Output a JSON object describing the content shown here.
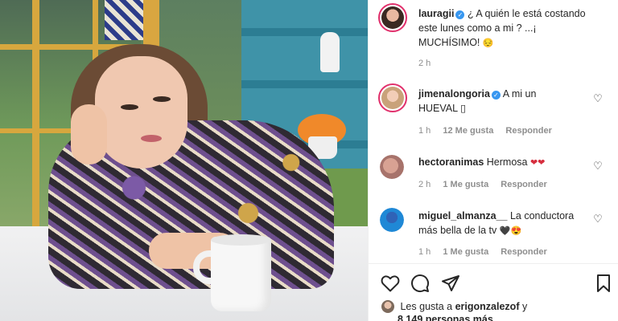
{
  "post": {
    "author": "lauragii",
    "caption_line1": "¿ A quién le está costando",
    "caption_line2": "este lunes como a mi ? ...¡",
    "caption_line3": "MUCHÍSIMO!",
    "caption_emoji": "😔",
    "time": "2 h"
  },
  "comments": [
    {
      "user": "jimenalongoria",
      "verified": true,
      "text_line1": "A mi un",
      "text_line2": "HUEVAL",
      "text_emoji": "▯",
      "time": "1 h",
      "likes": "12 Me gusta",
      "reply": "Responder"
    },
    {
      "user": "hectoranimas",
      "verified": false,
      "text_line1": "Hermosa",
      "text_emoji": "❤❤",
      "time": "2 h",
      "likes": "1 Me gusta",
      "reply": "Responder"
    },
    {
      "user": "miguel_almanza__",
      "verified": false,
      "text_line1": "La conductora",
      "text_line2": "más bella de la tv",
      "text_emoji": "🖤😍",
      "time": "1 h",
      "likes": "1 Me gusta",
      "reply": "Responder"
    }
  ],
  "likes_summary": {
    "prefix": "Les gusta a",
    "user": "erigonzalezof",
    "suffix": "y",
    "count": "8.149 personas más"
  },
  "icons": {
    "verified": "verified-badge-icon",
    "like": "heart-icon",
    "comment": "comment-bubble-icon",
    "share": "paper-plane-icon",
    "save": "bookmark-icon"
  },
  "colors": {
    "verified_blue": "#3897f0",
    "story_ring": "#e1306c",
    "hearts_red": "#d62d3d"
  }
}
